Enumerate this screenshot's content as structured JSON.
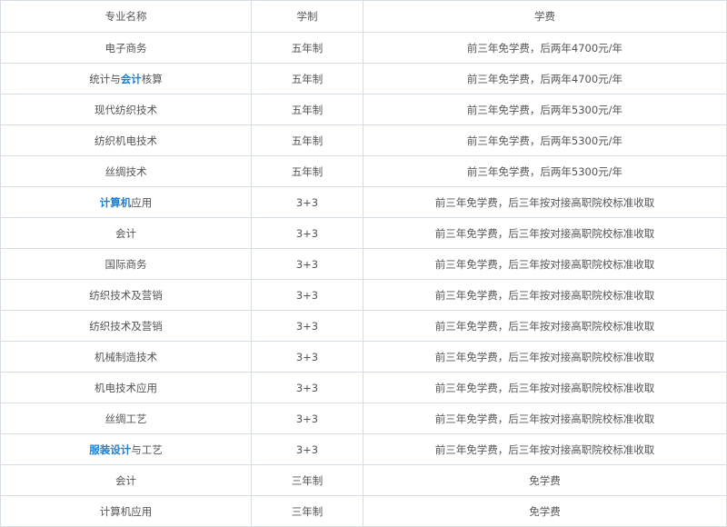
{
  "table": {
    "headers": [
      "专业名称",
      "学制",
      "学费"
    ],
    "rows": [
      {
        "name": [
          {
            "text": "电子商务",
            "hl": false
          }
        ],
        "duration": "五年制",
        "fee": "前三年免学费，后两年4700元/年"
      },
      {
        "name": [
          {
            "text": "统计与",
            "hl": false
          },
          {
            "text": "会计",
            "hl": true
          },
          {
            "text": "核算",
            "hl": false
          }
        ],
        "duration": "五年制",
        "fee": "前三年免学费，后两年4700元/年"
      },
      {
        "name": [
          {
            "text": "现代纺织技术",
            "hl": false
          }
        ],
        "duration": "五年制",
        "fee": "前三年免学费，后两年5300元/年"
      },
      {
        "name": [
          {
            "text": "纺织机电技术",
            "hl": false
          }
        ],
        "duration": "五年制",
        "fee": "前三年免学费，后两年5300元/年"
      },
      {
        "name": [
          {
            "text": "丝绸技术",
            "hl": false
          }
        ],
        "duration": "五年制",
        "fee": "前三年免学费，后两年5300元/年"
      },
      {
        "name": [
          {
            "text": "计算机",
            "hl": true
          },
          {
            "text": "应用",
            "hl": false
          }
        ],
        "duration": "3+3",
        "fee": "前三年免学费，后三年按对接高职院校标准收取"
      },
      {
        "name": [
          {
            "text": "会计",
            "hl": false
          }
        ],
        "duration": "3+3",
        "fee": "前三年免学费，后三年按对接高职院校标准收取"
      },
      {
        "name": [
          {
            "text": "国际商务",
            "hl": false
          }
        ],
        "duration": "3+3",
        "fee": "前三年免学费，后三年按对接高职院校标准收取"
      },
      {
        "name": [
          {
            "text": "纺织技术及营销",
            "hl": false
          }
        ],
        "duration": "3+3",
        "fee": "前三年免学费，后三年按对接高职院校标准收取"
      },
      {
        "name": [
          {
            "text": "纺织技术及营销",
            "hl": false
          }
        ],
        "duration": "3+3",
        "fee": "前三年免学费，后三年按对接高职院校标准收取"
      },
      {
        "name": [
          {
            "text": "机械制造技术",
            "hl": false
          }
        ],
        "duration": "3+3",
        "fee": "前三年免学费，后三年按对接高职院校标准收取"
      },
      {
        "name": [
          {
            "text": "机电技术应用",
            "hl": false
          }
        ],
        "duration": "3+3",
        "fee": "前三年免学费，后三年按对接高职院校标准收取"
      },
      {
        "name": [
          {
            "text": "丝绸工艺",
            "hl": false
          }
        ],
        "duration": "3+3",
        "fee": "前三年免学费，后三年按对接高职院校标准收取"
      },
      {
        "name": [
          {
            "text": "服装设计",
            "hl": true
          },
          {
            "text": "与工艺",
            "hl": false
          }
        ],
        "duration": "3+3",
        "fee": "前三年免学费，后三年按对接高职院校标准收取"
      },
      {
        "name": [
          {
            "text": "会计",
            "hl": false
          }
        ],
        "duration": "三年制",
        "fee": "免学费"
      },
      {
        "name": [
          {
            "text": "计算机应用",
            "hl": false
          }
        ],
        "duration": "三年制",
        "fee": "免学费"
      }
    ]
  },
  "colors": {
    "link": "#1e7fd0",
    "text": "#555555",
    "border": "#d6dde5"
  }
}
